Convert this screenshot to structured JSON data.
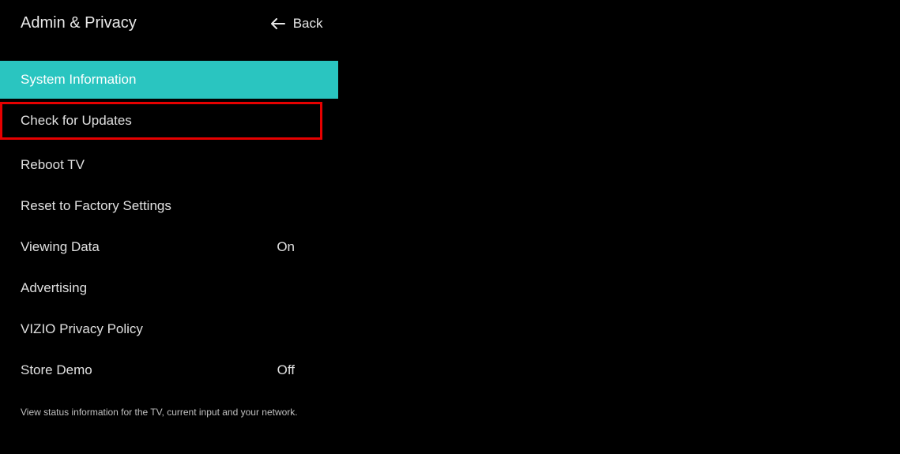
{
  "header": {
    "title": "Admin & Privacy",
    "back_label": "Back"
  },
  "menu": {
    "items": [
      {
        "label": "System Information",
        "value": "",
        "selected": true,
        "annotated": false
      },
      {
        "label": "Check for Updates",
        "value": "",
        "selected": false,
        "annotated": true
      },
      {
        "label": "Reboot TV",
        "value": "",
        "selected": false,
        "annotated": false
      },
      {
        "label": "Reset to Factory Settings",
        "value": "",
        "selected": false,
        "annotated": false
      },
      {
        "label": "Viewing Data",
        "value": "On",
        "selected": false,
        "annotated": false
      },
      {
        "label": "Advertising",
        "value": "",
        "selected": false,
        "annotated": false
      },
      {
        "label": "VIZIO Privacy Policy",
        "value": "",
        "selected": false,
        "annotated": false
      },
      {
        "label": "Store Demo",
        "value": "Off",
        "selected": false,
        "annotated": false
      }
    ]
  },
  "description": "View status information for the TV, current input and your network."
}
